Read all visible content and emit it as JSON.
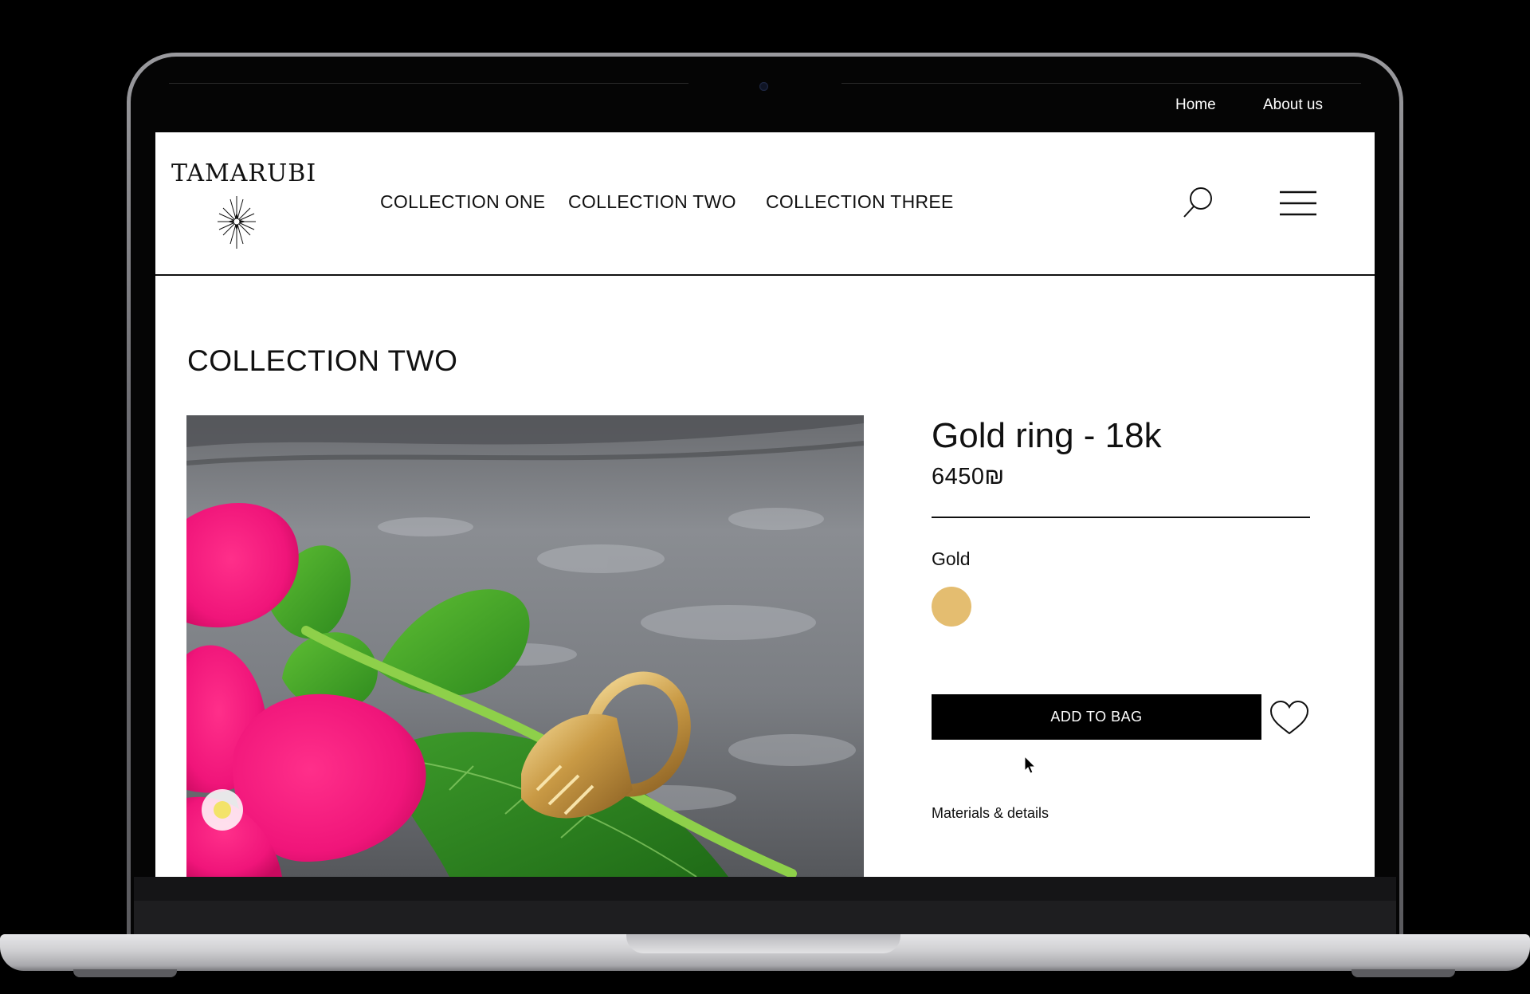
{
  "top_nav": {
    "home": "Home",
    "about": "About us"
  },
  "brand": {
    "name": "TAMARUBI"
  },
  "main_nav": {
    "items": [
      "COLLECTION ONE",
      "COLLECTION TWO",
      "COLLECTION THREE"
    ]
  },
  "header_icons": {
    "search": "search-icon",
    "menu": "hamburger-menu-icon"
  },
  "page": {
    "collection_title": "COLLECTION TWO"
  },
  "product": {
    "name": "Gold ring - 18k",
    "price": "6450₪",
    "color_label": "Gold",
    "swatch_color": "#E4BD70",
    "add_to_bag": "ADD TO BAG",
    "wishlist_icon": "heart-icon",
    "details_link": "Materials & details"
  },
  "colors": {
    "top_bar": "#000000",
    "page_bg": "#FFFFFF",
    "text": "#111111",
    "button_bg": "#000000",
    "button_text": "#FFFFFF"
  }
}
